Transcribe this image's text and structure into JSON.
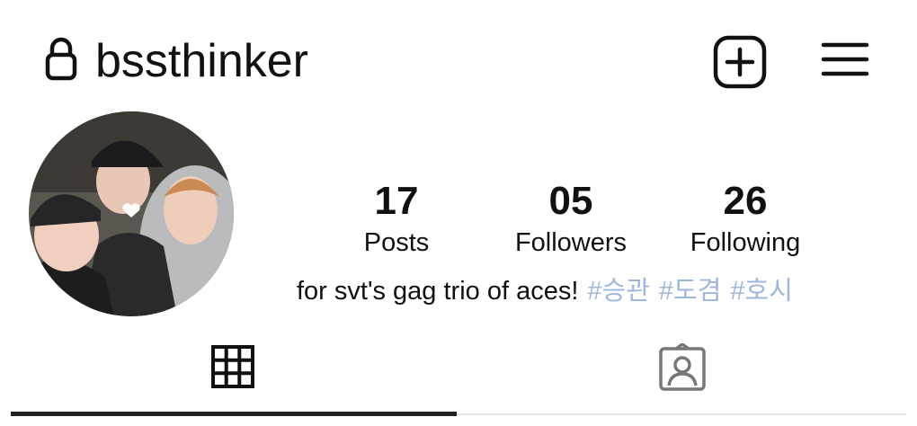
{
  "header": {
    "username": "bssthinker",
    "lock_icon": "lock-icon",
    "add_icon": "add-post-icon",
    "menu_icon": "hamburger-menu-icon"
  },
  "profile": {
    "avatar": "profile-avatar",
    "stats": [
      {
        "value": "17",
        "label": "Posts"
      },
      {
        "value": "05",
        "label": "Followers"
      },
      {
        "value": "26",
        "label": "Following"
      }
    ],
    "bio": {
      "text": "for svt's gag trio of aces!",
      "hashtags": [
        "#승관",
        "#도겸",
        "#호시"
      ]
    }
  },
  "tabs": {
    "items": [
      {
        "icon": "grid-icon",
        "selected": true
      },
      {
        "icon": "tagged-user-icon",
        "selected": false
      }
    ]
  },
  "colors": {
    "text": "#111111",
    "hashtag": "#9fb7de",
    "tab_active": "#222222",
    "icon_inactive": "#777777"
  }
}
